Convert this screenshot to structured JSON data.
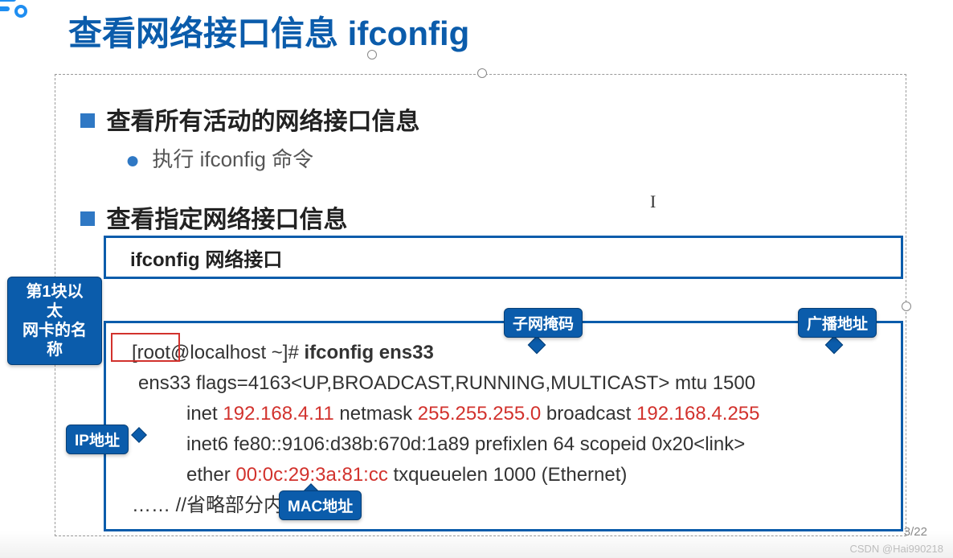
{
  "title": "查看网络接口信息 ifconfig",
  "bullets": {
    "b1": "查看所有活动的网络接口信息",
    "b1sub": "执行 ifconfig 命令",
    "b2": "查看指定网络接口信息"
  },
  "box1": "ifconfig 网络接口",
  "terminal": {
    "prompt": "[root@localhost ~]# ",
    "cmd": "ifconfig ens33",
    "l2a": "ens33   flags=4163<UP,BROADCAST,RUNNING,MULTICAST>  mtu 1500",
    "l3a": "inet ",
    "l3ip": "192.168.4.11",
    "l3b": "  netmask ",
    "l3mask": "255.255.255.0",
    "l3c": "  broadcast ",
    "l3bc": "192.168.4.255",
    "l4": "inet6 fe80::9106:d38b:670d:1a89  prefixlen 64  scopeid 0x20<link>",
    "l5a": "ether ",
    "l5mac": "00:0c:29:3a:81:cc",
    "l5b": "  txqueuelen 1000  (Ethernet)",
    "omit": "…… //省略部分内容"
  },
  "callouts": {
    "eth1": "第1块以太",
    "eth2": "网卡的名称",
    "subnet": "子网掩码",
    "broadcast": "广播地址",
    "ip": "IP地址",
    "mac": "MAC地址"
  },
  "watermark": "CSDN @Hai990218",
  "page": "3/22"
}
